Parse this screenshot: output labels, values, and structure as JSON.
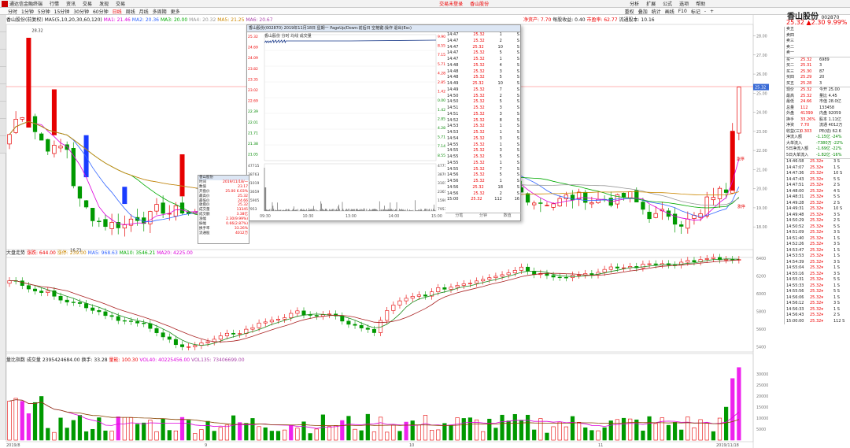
{
  "menu": {
    "app": "通达信金融终端",
    "items": [
      "行情",
      "资讯",
      "交易",
      "发现",
      "交易"
    ],
    "center": "交易未登录",
    "center2": "香山股份",
    "right": [
      "分析",
      "扩展",
      "公式",
      "选项",
      "帮助"
    ]
  },
  "tabs": [
    "分时",
    "1分钟",
    "5分钟",
    "15分钟",
    "30分钟",
    "60分钟",
    "日线",
    "周线",
    "月线",
    "多周期",
    "更多"
  ],
  "tab_selected": "日线",
  "toolbar_right": [
    "重权",
    "叠加",
    "统计",
    "画线",
    "F10",
    "标记",
    "-",
    "+"
  ],
  "stock": {
    "name": "香山股份",
    "code": "002870",
    "price": "25.32",
    "change": "▲2.30",
    "pct": "9.99%"
  },
  "quote": [
    {
      "l": "卖五",
      "v": "",
      "n": ""
    },
    {
      "l": "卖四",
      "v": "",
      "n": ""
    },
    {
      "l": "卖三",
      "v": "",
      "n": ""
    },
    {
      "l": "卖二",
      "v": "",
      "n": ""
    },
    {
      "l": "卖一",
      "v": "",
      "n": ""
    },
    {
      "l": "买一",
      "v": "25.32",
      "n": "6989"
    },
    {
      "l": "买二",
      "v": "25.31",
      "n": "3"
    },
    {
      "l": "买三",
      "v": "25.30",
      "n": "87"
    },
    {
      "l": "买四",
      "v": "25.29",
      "n": "20"
    },
    {
      "l": "买五",
      "v": "25.28",
      "n": "3"
    },
    {
      "l": "现价",
      "v": "25.32",
      "n": "今开 25.00"
    },
    {
      "l": "最高",
      "v": "25.32",
      "n": "量比 4.45"
    },
    {
      "l": "最低",
      "v": "24.66",
      "n": "市值 28.0亿"
    },
    {
      "l": "总量",
      "v": "112",
      "n": "133458"
    },
    {
      "l": "外盘",
      "v": "41399",
      "n": "内盘 92059"
    },
    {
      "l": "换手",
      "v": "33.26%",
      "n": "股本 1.11亿"
    },
    {
      "l": "净资",
      "v": "7.70",
      "n": "流通 4012万"
    },
    {
      "l": "收益(三)",
      "v": "0.303",
      "n": "PE(动) 62.6"
    }
  ],
  "flows": [
    {
      "l": "净流入额",
      "v": "-1.15亿 -24%"
    },
    {
      "l": "大单流入",
      "v": "-7380万 -22%"
    },
    {
      "l": "5日净流入额",
      "v": "-1.69亿 -22%"
    },
    {
      "l": "5日大单流入",
      "v": "-1.82亿 -16%"
    }
  ],
  "trades": [
    [
      "14:46:58",
      "25.32",
      "3"
    ],
    [
      "14:47:07",
      "25.32",
      "1"
    ],
    [
      "14:47:36",
      "25.32",
      "10"
    ],
    [
      "14:47:43",
      "25.32",
      "5"
    ],
    [
      "14:47:51",
      "25.32",
      "2"
    ],
    [
      "14:48:00",
      "25.32",
      "4"
    ],
    [
      "14:48:31",
      "25.32",
      "5"
    ],
    [
      "14:49:28",
      "25.32",
      "2"
    ],
    [
      "14:49:31",
      "25.32",
      "10"
    ],
    [
      "14:49:48",
      "25.32",
      "3"
    ],
    [
      "14:50:29",
      "25.32",
      "2"
    ],
    [
      "14:50:52",
      "25.32",
      "5"
    ],
    [
      "14:51:09",
      "25.32",
      "3"
    ],
    [
      "14:51:40",
      "25.32",
      "1"
    ],
    [
      "14:52:26",
      "25.32",
      "3"
    ],
    [
      "14:53:47",
      "25.32",
      "1"
    ],
    [
      "14:53:53",
      "25.32",
      "1"
    ],
    [
      "14:54:39",
      "25.32",
      "3"
    ],
    [
      "14:55:04",
      "25.32",
      "1"
    ],
    [
      "14:55:16",
      "25.32",
      "3"
    ],
    [
      "14:55:31",
      "25.32",
      "5"
    ],
    [
      "14:55:33",
      "25.32",
      "1"
    ],
    [
      "14:55:56",
      "25.32",
      "5"
    ],
    [
      "14:56:06",
      "25.32",
      "1"
    ],
    [
      "14:56:12",
      "25.32",
      "3"
    ],
    [
      "14:56:33",
      "25.32",
      "1"
    ],
    [
      "14:56:43",
      "25.32",
      "2"
    ],
    [
      "15:00:00",
      "25.32",
      "112"
    ],
    [
      "14:47",
      "25.32",
      "1"
    ],
    [
      "14:48",
      "25.32",
      "5"
    ],
    [
      "14:49",
      "25.32",
      "7"
    ],
    [
      "14:50",
      "25.32",
      "4"
    ],
    [
      "14:51",
      "25.32",
      "3"
    ],
    [
      "14:52",
      "25.32",
      "10"
    ]
  ],
  "main_header": {
    "name": "香山股份(前复权)",
    "ma_label": "MA5(5,10,20,30,60,120)",
    "ma1": "MA1: 21.46",
    "ma2": "MA2: 20.36",
    "ma3": "MA3: 20.00",
    "ma4": "MA4: 20.32",
    "ma5": "MA5: 21.25",
    "ma6": "MA6: 20.67"
  },
  "main_info": {
    "a": "净资产: 7.70",
    "b": "每股收益: 0.40",
    "c": "市盈率: 62.77",
    "d": "流通股本: 10.16"
  },
  "main_axis": [
    "28.00",
    "27.00",
    "26.00",
    "25.00",
    "24.00",
    "23.00",
    "22.00",
    "21.00",
    "20.00",
    "19.00",
    "18.00"
  ],
  "main_hi": "28.32",
  "main_lo": "16.73",
  "main_last": "25.32",
  "ind_header": {
    "name": "大盘走势",
    "a": "涨跌: 644.00",
    "b": "涨停: 239.00",
    "c": "MA5: 968.63",
    "d": "MA10: 3546.21",
    "e": "MA20: 4225.00"
  },
  "ind_axis": [
    "6400",
    "6200",
    "6000",
    "5800",
    "5600",
    "5400"
  ],
  "vol_header": {
    "name": "量比指数 成交量",
    "a": "2395424684.00",
    "b": "换手: 33.28",
    "c": "量能: 100.30",
    "d": "VOL40: 40225456.00",
    "e": "VOL135: 73406699.00"
  },
  "vol_axis": [
    "30000",
    "25000",
    "20000",
    "15000",
    "10000",
    "5000"
  ],
  "date_axis": [
    "2019/8",
    "9",
    "10",
    "11",
    "2019/11/18"
  ],
  "popup": {
    "title": "香山股份(002870) 2019年11月18日 星期一 PageUp/Down:前后日 空格键:操作 退出(Esc)",
    "tabs": "香山股份  分时  均线  成交量",
    "times": [
      "09:30",
      "10:30",
      "13:00",
      "14:00",
      "15:00"
    ]
  },
  "popup_axis_l": [
    "25.32",
    "24.69",
    "24.09",
    "23.82",
    "23.35",
    "23.02",
    "22.69",
    "22.39",
    "22.01",
    "21.71",
    "21.38",
    "21.05",
    "47715",
    "38763",
    "31019",
    "23659",
    "15905",
    "7953"
  ],
  "popup_axis_r": [
    "9.90%",
    "8.55%",
    "7.15%",
    "5.71%",
    "4.28%",
    "2.85%",
    "1.42%",
    "0.00%",
    "1.42%",
    "2.85%",
    "4.28%",
    "5.71%",
    "7.14%",
    "8.55%",
    "47715",
    "38763",
    "31019",
    "23659",
    "15905",
    "7953"
  ],
  "popup_ticks": [
    [
      "14:47",
      "25.32",
      "1",
      "S"
    ],
    [
      "14:47",
      "25.32",
      "2",
      "S"
    ],
    [
      "14:47",
      "25.32",
      "10",
      "S"
    ],
    [
      "14:47",
      "25.32",
      "5",
      "S"
    ],
    [
      "14:47",
      "25.32",
      "1",
      "S"
    ],
    [
      "14:48",
      "25.32",
      "4",
      "S"
    ],
    [
      "14:48",
      "25.32",
      "3",
      "S"
    ],
    [
      "14:48",
      "25.32",
      "5",
      "S"
    ],
    [
      "14:49",
      "25.32",
      "10",
      "S"
    ],
    [
      "14:49",
      "25.32",
      "7",
      "S"
    ],
    [
      "14:50",
      "25.32",
      "2",
      "S"
    ],
    [
      "14:50",
      "25.32",
      "5",
      "S"
    ],
    [
      "14:51",
      "25.32",
      "3",
      "S"
    ],
    [
      "14:51",
      "25.32",
      "3",
      "S"
    ],
    [
      "14:52",
      "25.32",
      "8",
      "S"
    ],
    [
      "14:53",
      "25.32",
      "1",
      "S"
    ],
    [
      "14:53",
      "25.32",
      "1",
      "S"
    ],
    [
      "14:54",
      "25.32",
      "3",
      "S"
    ],
    [
      "14:55",
      "25.32",
      "1",
      "S"
    ],
    [
      "14:55",
      "25.32",
      "3",
      "S"
    ],
    [
      "14:55",
      "25.32",
      "5",
      "S"
    ],
    [
      "14:55",
      "25.32",
      "1",
      "S"
    ],
    [
      "14:55",
      "25.32",
      "7",
      "S"
    ],
    [
      "14:56",
      "25.32",
      "5",
      "S"
    ],
    [
      "14:56",
      "25.32",
      "1",
      "S"
    ],
    [
      "14:56",
      "25.32",
      "18",
      "S"
    ],
    [
      "14:56",
      "25.32",
      "2",
      "S"
    ],
    [
      "15:00",
      "25.32",
      "112",
      "16"
    ]
  ],
  "popup_footer": [
    "分笔",
    "分钟",
    "数值"
  ],
  "infobox": {
    "title": "香山股份",
    "rows": [
      [
        "时间",
        "2019/11/18/一"
      ],
      [
        "数值",
        "23.17"
      ],
      [
        "开盘价",
        "25.00 6.03%"
      ],
      [
        "最高价",
        "25.32"
      ],
      [
        "最低价",
        "24.66"
      ],
      [
        "收盘价",
        "25.32"
      ],
      [
        "成交量",
        "13345"
      ],
      [
        "成交额",
        "3.38亿"
      ],
      [
        "涨幅",
        "2.30(9.99%)"
      ],
      [
        "振幅",
        "0.66(2.87%)"
      ],
      [
        "换手率",
        "33.26%"
      ],
      [
        "流通股",
        "4012万"
      ]
    ]
  },
  "labels": {
    "zt": "涨停",
    "cf": "涨停"
  },
  "colors": {
    "up": "#e60000",
    "down": "#009900",
    "ma1": "#dd00dd",
    "ma2": "#3366ff",
    "ma3": "#00aa00",
    "ma4": "#999999",
    "ma5": "#cc8800",
    "ma6": "#aa44aa"
  }
}
